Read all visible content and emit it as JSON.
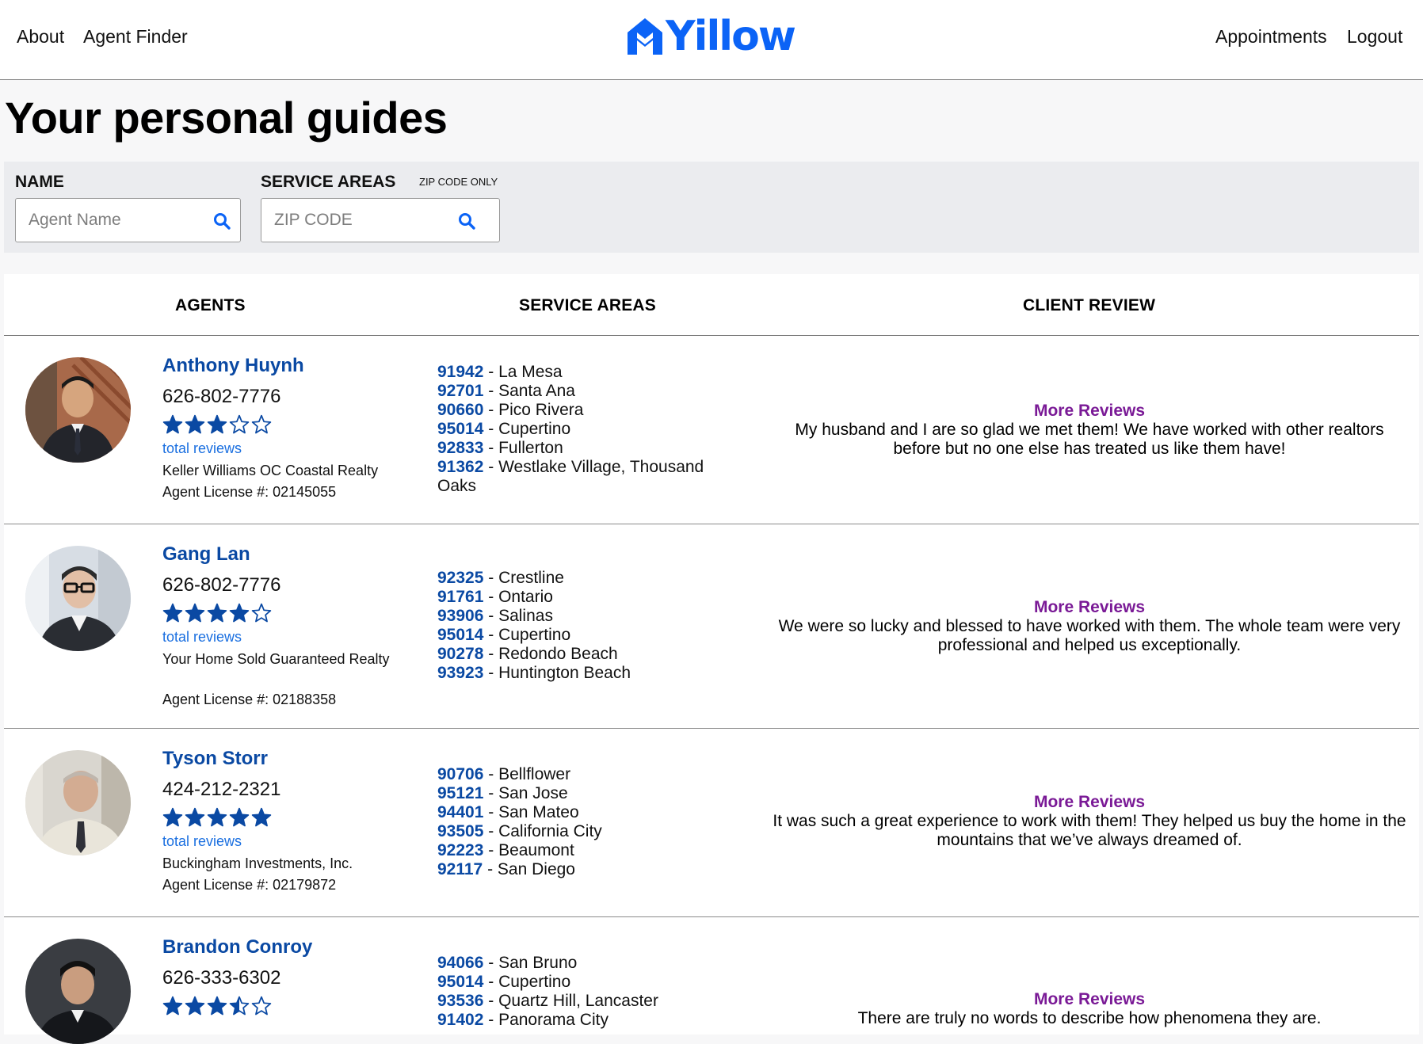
{
  "nav": {
    "about": "About",
    "agent_finder": "Agent Finder",
    "appointments": "Appointments",
    "logout": "Logout"
  },
  "brand": {
    "logo_text": "Yillow",
    "color": "#0b63f6"
  },
  "page_title": "Your personal guides",
  "filters": {
    "name_label": "NAME",
    "name_placeholder": "Agent Name",
    "areas_label": "SERVICE AREAS",
    "areas_hint": "ZIP CODE ONLY",
    "zip_placeholder": "ZIP CODE",
    "search_icon": "search-icon"
  },
  "table": {
    "headers": {
      "agents": "AGENTS",
      "service_areas": "SERVICE AREAS",
      "client_review": "CLIENT REVIEW"
    }
  },
  "colors": {
    "name": "#0a49a3",
    "zip": "#0a49a3",
    "star": "#0a49a3",
    "more_reviews": "#7a1a96",
    "reviews_link": "#1a6fe0"
  },
  "agents": [
    {
      "name": "Anthony Huynh",
      "phone": "626-802-7776",
      "rating": 3,
      "reviews_label": "total reviews",
      "company": "Keller Williams OC Coastal Realty",
      "license": "Agent License #: 02145055",
      "areas": [
        {
          "zip": "91942",
          "city": " - La Mesa"
        },
        {
          "zip": "92701",
          "city": " - Santa Ana"
        },
        {
          "zip": "90660",
          "city": " - Pico Rivera"
        },
        {
          "zip": "95014",
          "city": " - Cupertino"
        },
        {
          "zip": "92833",
          "city": " - Fullerton"
        },
        {
          "zip": "91362",
          "city": " - Westlake Village, Thousand Oaks"
        }
      ],
      "more_reviews": "More Reviews",
      "review": "My husband and I are so glad we met them! We have worked with other realtors before but no one else has treated us like them have!"
    },
    {
      "name": "Gang Lan",
      "phone": "626-802-7776",
      "rating": 4,
      "reviews_label": "total reviews",
      "company": "Your Home Sold Guaranteed Realty",
      "license": "Agent License #: 02188358",
      "areas": [
        {
          "zip": "92325",
          "city": " - Crestline"
        },
        {
          "zip": "91761",
          "city": " - Ontario"
        },
        {
          "zip": "93906",
          "city": " - Salinas"
        },
        {
          "zip": "95014",
          "city": " - Cupertino"
        },
        {
          "zip": "90278",
          "city": " - Redondo Beach"
        },
        {
          "zip": "93923",
          "city": " - Huntington Beach"
        }
      ],
      "more_reviews": "More Reviews",
      "review": "We were so lucky and blessed to have worked with them. The whole team were very professional and helped us exceptionally."
    },
    {
      "name": "Tyson Storr",
      "phone": "424-212-2321",
      "rating": 5,
      "reviews_label": "total reviews",
      "company": "Buckingham Investments, Inc.",
      "license": "Agent License #: 02179872",
      "areas": [
        {
          "zip": "90706",
          "city": " - Bellflower"
        },
        {
          "zip": "95121",
          "city": " - San Jose"
        },
        {
          "zip": "94401",
          "city": " - San Mateo"
        },
        {
          "zip": "93505",
          "city": " - California City"
        },
        {
          "zip": "92223",
          "city": " - Beaumont"
        },
        {
          "zip": "92117",
          "city": " - San Diego"
        }
      ],
      "more_reviews": "More Reviews",
      "review": "It was such a great experience to work with them! They helped us buy the home in the mountains that we’ve always dreamed of."
    },
    {
      "name": "Brandon Conroy",
      "phone": "626-333-6302",
      "rating": 3.5,
      "areas": [
        {
          "zip": "94066",
          "city": " - San Bruno"
        },
        {
          "zip": "95014",
          "city": " - Cupertino"
        },
        {
          "zip": "93536",
          "city": " - Quartz Hill, Lancaster"
        },
        {
          "zip": "91402",
          "city": " - Panorama City"
        }
      ],
      "more_reviews": "More Reviews",
      "review": "There are truly no words to describe how phenomena they are."
    }
  ]
}
